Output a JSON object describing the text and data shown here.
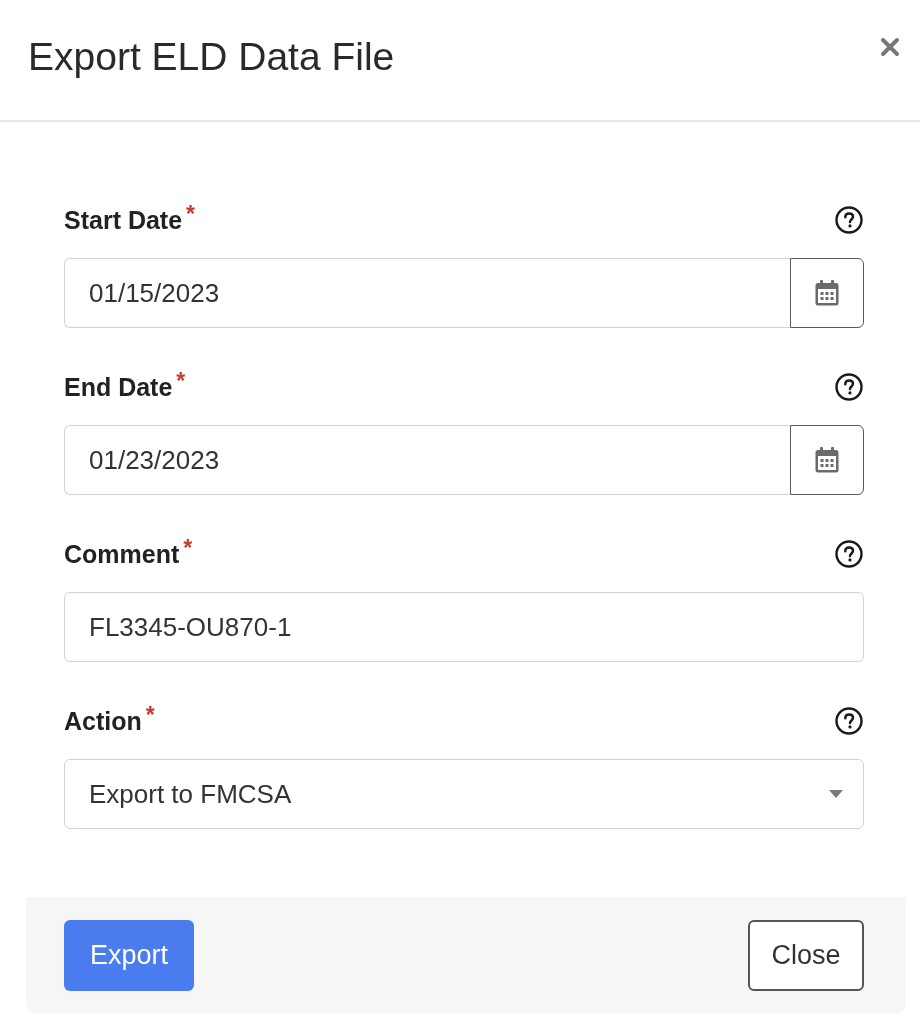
{
  "dialog": {
    "title": "Export ELD Data File"
  },
  "fields": [
    {
      "kind": "date",
      "label": "Start Date",
      "required_mark": "*",
      "value": "01/15/2023"
    },
    {
      "kind": "date",
      "label": "End Date",
      "required_mark": "*",
      "value": "01/23/2023"
    },
    {
      "kind": "text",
      "label": "Comment",
      "required_mark": "*",
      "value": "FL3345-OU870-1"
    },
    {
      "kind": "select",
      "label": "Action",
      "required_mark": "*",
      "value": "Export to FMCSA"
    }
  ],
  "footer": {
    "buttons": [
      {
        "kind": "primary",
        "label": "Export"
      },
      {
        "kind": "secondary",
        "label": "Close"
      }
    ]
  }
}
